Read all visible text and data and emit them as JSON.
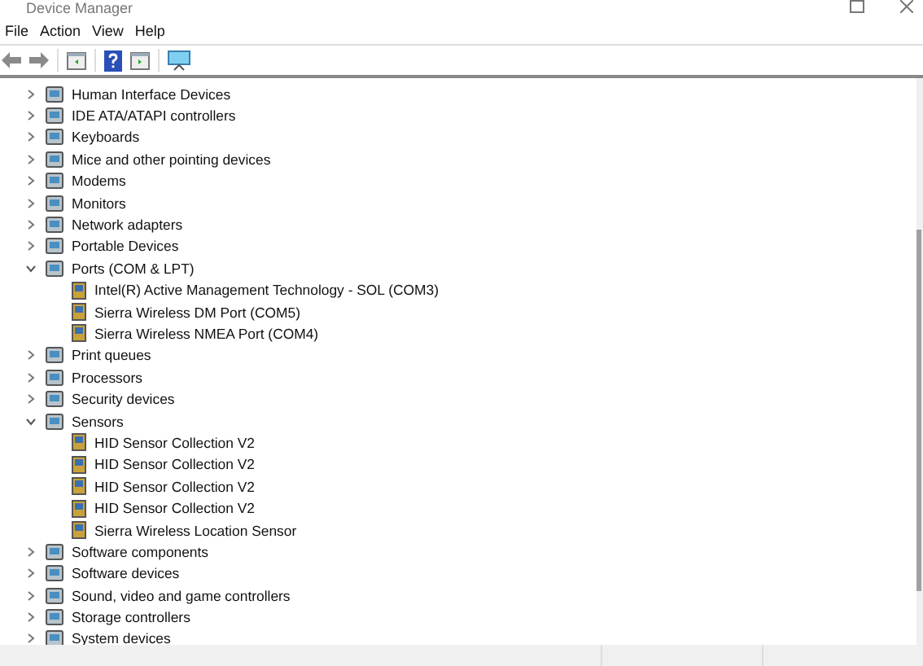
{
  "window": {
    "title": "Device Manager"
  },
  "menu": [
    "File",
    "Action",
    "View",
    "Help"
  ],
  "tree": [
    {
      "label": "Human Interface Devices",
      "expanded": false
    },
    {
      "label": "IDE ATA/ATAPI controllers",
      "expanded": false
    },
    {
      "label": "Keyboards",
      "expanded": false
    },
    {
      "label": "Mice and other pointing devices",
      "expanded": false
    },
    {
      "label": "Modems",
      "expanded": false
    },
    {
      "label": "Monitors",
      "expanded": false
    },
    {
      "label": "Network adapters",
      "expanded": false
    },
    {
      "label": "Portable Devices",
      "expanded": false
    },
    {
      "label": "Ports (COM & LPT)",
      "expanded": true,
      "children": [
        {
          "label": "Intel(R) Active Management Technology - SOL (COM3)"
        },
        {
          "label": "Sierra Wireless DM Port (COM5)"
        },
        {
          "label": "Sierra Wireless NMEA Port (COM4)"
        }
      ]
    },
    {
      "label": "Print queues",
      "expanded": false
    },
    {
      "label": "Processors",
      "expanded": false
    },
    {
      "label": "Security devices",
      "expanded": false
    },
    {
      "label": "Sensors",
      "expanded": true,
      "children": [
        {
          "label": "HID Sensor Collection V2"
        },
        {
          "label": "HID Sensor Collection V2"
        },
        {
          "label": "HID Sensor Collection V2"
        },
        {
          "label": "HID Sensor Collection V2"
        },
        {
          "label": "Sierra Wireless Location Sensor"
        }
      ]
    },
    {
      "label": "Software components",
      "expanded": false
    },
    {
      "label": "Software devices",
      "expanded": false
    },
    {
      "label": "Sound, video and game controllers",
      "expanded": false
    },
    {
      "label": "Storage controllers",
      "expanded": false
    },
    {
      "label": "System devices",
      "expanded": false
    }
  ]
}
